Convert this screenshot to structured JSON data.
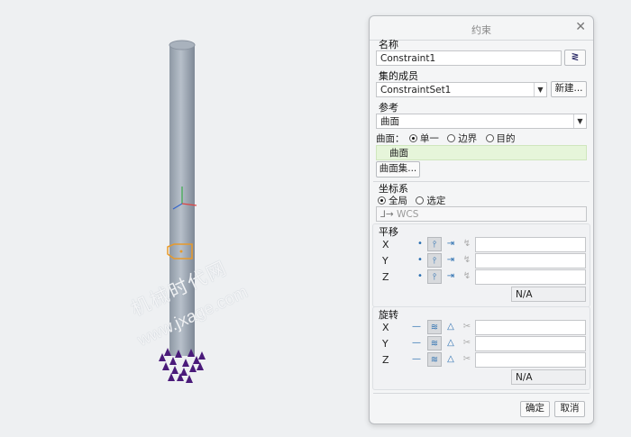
{
  "watermark": {
    "line1": "机械时代网",
    "line2": "www.jxage.com"
  },
  "dialog": {
    "title": "约束",
    "close_glyph": "✕",
    "name": {
      "label": "名称",
      "value": "Constraint1"
    },
    "set_member": {
      "label": "集的成员",
      "value": "ConstraintSet1",
      "new_button": "新建..."
    },
    "reference": {
      "label": "参考",
      "type_value": "曲面",
      "filter_label": "曲面：",
      "options": [
        "单一",
        "边界",
        "目的"
      ],
      "selected_option": "单一",
      "selection": "曲面",
      "surface_set_button": "曲面集..."
    },
    "csys": {
      "label": "坐标系",
      "options": [
        "全局",
        "选定"
      ],
      "selected": "全局",
      "value": "WCS"
    },
    "translation": {
      "label": "平移",
      "axes": [
        "X",
        "Y",
        "Z"
      ],
      "na": "N/A"
    },
    "rotation": {
      "label": "旋转",
      "axes": [
        "X",
        "Y",
        "Z"
      ],
      "na": "N/A"
    },
    "ok_button": "确定",
    "cancel_button": "取消"
  },
  "colors": {
    "accent": "#2b6fb0",
    "selection_bg": "#e6f5da",
    "constraint": "#4a1a7a",
    "tag": "#e89a2a"
  }
}
